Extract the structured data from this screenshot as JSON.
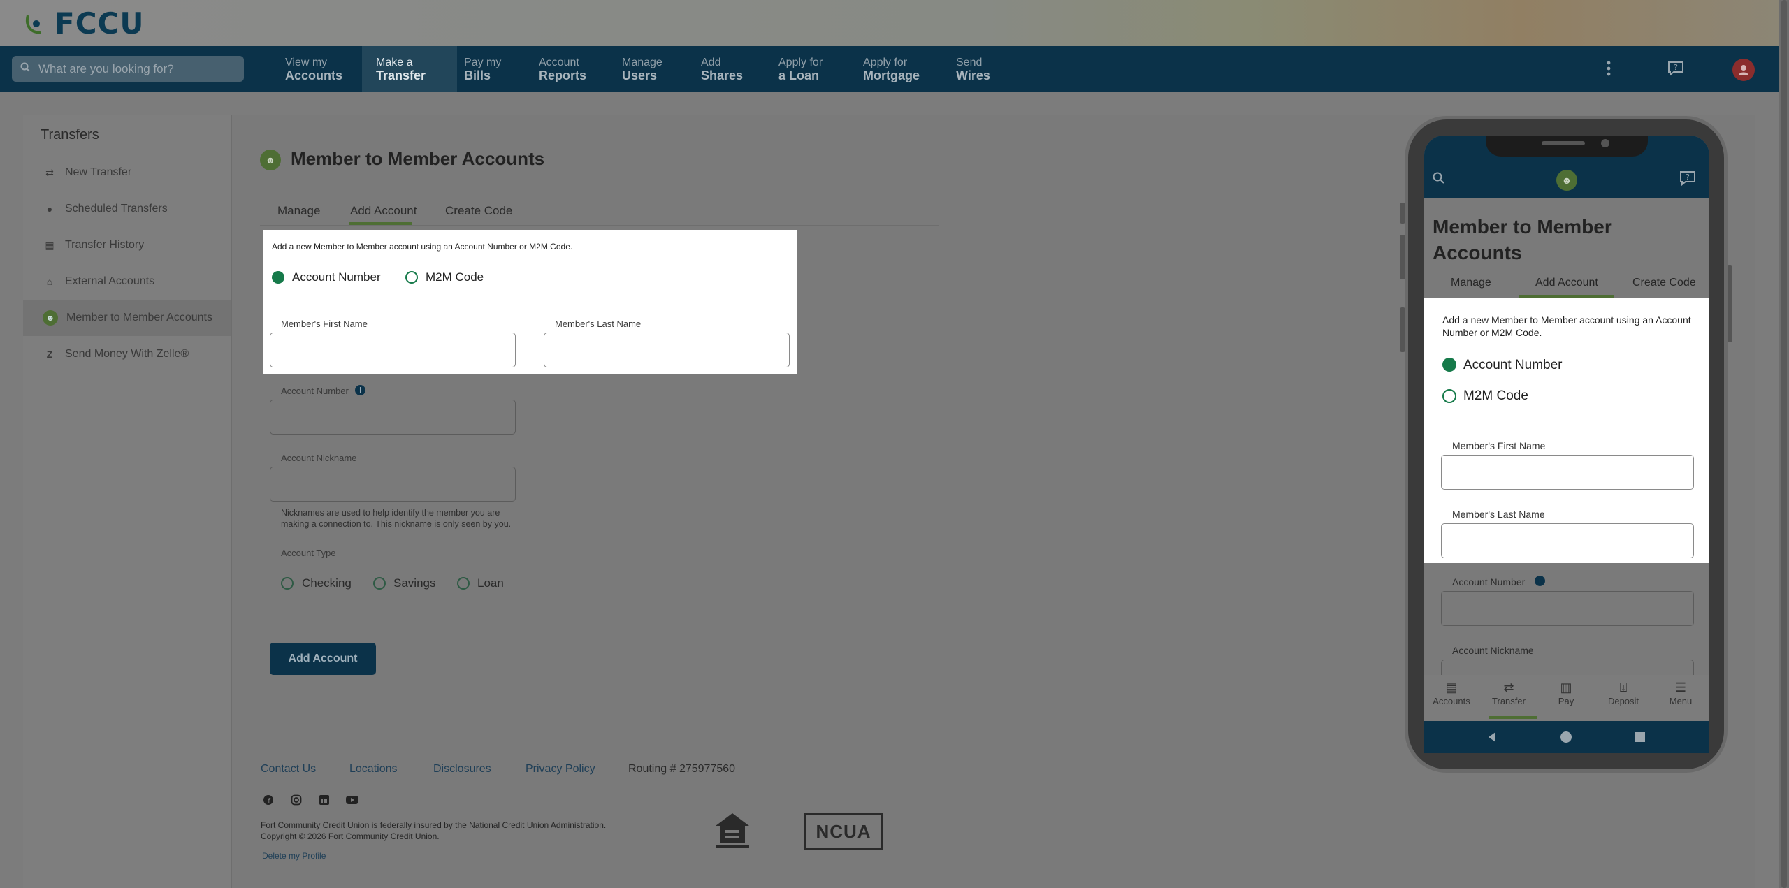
{
  "brand": {
    "logo_text": "FCCU"
  },
  "search": {
    "placeholder": "What are you looking for?"
  },
  "nav": [
    {
      "top": "View my",
      "bottom": "Accounts"
    },
    {
      "top": "Make a",
      "bottom": "Transfer"
    },
    {
      "top": "Pay my",
      "bottom": "Bills"
    },
    {
      "top": "Account",
      "bottom": "Reports"
    },
    {
      "top": "Manage",
      "bottom": "Users"
    },
    {
      "top": "Add",
      "bottom": "Shares"
    },
    {
      "top": "Apply for",
      "bottom": "a Loan"
    },
    {
      "top": "Apply for",
      "bottom": "Mortgage"
    },
    {
      "top": "Send",
      "bottom": "Wires"
    }
  ],
  "sidebar": {
    "title": "Transfers",
    "items": [
      {
        "label": "New Transfer",
        "icon": "swap-icon"
      },
      {
        "label": "Scheduled Transfers",
        "icon": "clock-icon"
      },
      {
        "label": "Transfer History",
        "icon": "calendar-icon"
      },
      {
        "label": "External Accounts",
        "icon": "bank-icon"
      },
      {
        "label": "Member to Member Accounts",
        "icon": "members-icon"
      },
      {
        "label": "Send Money With Zelle®",
        "icon": "zelle-icon"
      }
    ]
  },
  "main": {
    "title": "Member to Member Accounts",
    "tabs": [
      "Manage",
      "Add Account",
      "Create Code"
    ],
    "intro": "Add a new Member to Member account using an Account Number or M2M Code.",
    "method_options": [
      "Account Number",
      "M2M Code"
    ],
    "first_name_label": "Member's First Name",
    "last_name_label": "Member's Last Name",
    "account_number_label": "Account Number",
    "nickname_label": "Account Nickname",
    "nickname_help_1": "Nicknames are used to help identify the member you are",
    "nickname_help_2": "making a connection to. This nickname is only seen by you.",
    "account_type_label": "Account Type",
    "account_types": [
      "Checking",
      "Savings",
      "Loan"
    ],
    "submit": "Add Account"
  },
  "footer": {
    "links": [
      "Contact Us",
      "Locations",
      "Disclosures",
      "Privacy Policy"
    ],
    "routing": "Routing # 275977560",
    "legal_1": "Fort Community Credit Union is federally insured by the National Credit Union Administration.",
    "legal_2": "Copyright © 2026 Fort Community Credit Union.",
    "delete_profile": "Delete my Profile",
    "ncua": "NCUA"
  },
  "phone": {
    "title": "Member to Member Accounts",
    "tabs": [
      "Manage",
      "Add Account",
      "Create Code"
    ],
    "intro": "Add a new Member to Member account using an Account Number or M2M Code.",
    "options": [
      "Account Number",
      "M2M Code"
    ],
    "first_name_label": "Member's First Name",
    "last_name_label": "Member's Last Name",
    "account_number_label": "Account Number",
    "nickname_label": "Account Nickname",
    "bottom_nav": [
      "Accounts",
      "Transfer",
      "Pay",
      "Deposit",
      "Menu"
    ]
  },
  "colors": {
    "brand_navy": "#0b3249",
    "accent_green": "#4e6e34",
    "radio_green": "#167a4a"
  }
}
